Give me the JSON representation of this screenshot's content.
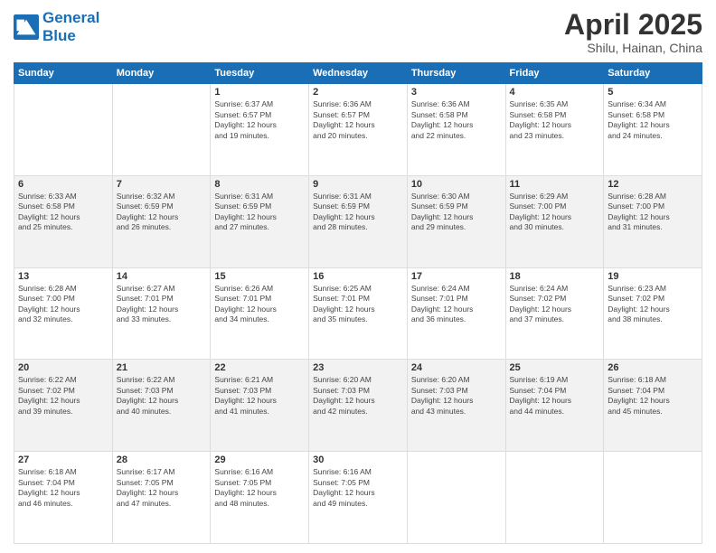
{
  "header": {
    "logo_line1": "General",
    "logo_line2": "Blue",
    "title": "April 2025",
    "subtitle": "Shilu, Hainan, China"
  },
  "days_of_week": [
    "Sunday",
    "Monday",
    "Tuesday",
    "Wednesday",
    "Thursday",
    "Friday",
    "Saturday"
  ],
  "weeks": [
    [
      {
        "day": "",
        "info": ""
      },
      {
        "day": "",
        "info": ""
      },
      {
        "day": "1",
        "info": "Sunrise: 6:37 AM\nSunset: 6:57 PM\nDaylight: 12 hours\nand 19 minutes."
      },
      {
        "day": "2",
        "info": "Sunrise: 6:36 AM\nSunset: 6:57 PM\nDaylight: 12 hours\nand 20 minutes."
      },
      {
        "day": "3",
        "info": "Sunrise: 6:36 AM\nSunset: 6:58 PM\nDaylight: 12 hours\nand 22 minutes."
      },
      {
        "day": "4",
        "info": "Sunrise: 6:35 AM\nSunset: 6:58 PM\nDaylight: 12 hours\nand 23 minutes."
      },
      {
        "day": "5",
        "info": "Sunrise: 6:34 AM\nSunset: 6:58 PM\nDaylight: 12 hours\nand 24 minutes."
      }
    ],
    [
      {
        "day": "6",
        "info": "Sunrise: 6:33 AM\nSunset: 6:58 PM\nDaylight: 12 hours\nand 25 minutes."
      },
      {
        "day": "7",
        "info": "Sunrise: 6:32 AM\nSunset: 6:59 PM\nDaylight: 12 hours\nand 26 minutes."
      },
      {
        "day": "8",
        "info": "Sunrise: 6:31 AM\nSunset: 6:59 PM\nDaylight: 12 hours\nand 27 minutes."
      },
      {
        "day": "9",
        "info": "Sunrise: 6:31 AM\nSunset: 6:59 PM\nDaylight: 12 hours\nand 28 minutes."
      },
      {
        "day": "10",
        "info": "Sunrise: 6:30 AM\nSunset: 6:59 PM\nDaylight: 12 hours\nand 29 minutes."
      },
      {
        "day": "11",
        "info": "Sunrise: 6:29 AM\nSunset: 7:00 PM\nDaylight: 12 hours\nand 30 minutes."
      },
      {
        "day": "12",
        "info": "Sunrise: 6:28 AM\nSunset: 7:00 PM\nDaylight: 12 hours\nand 31 minutes."
      }
    ],
    [
      {
        "day": "13",
        "info": "Sunrise: 6:28 AM\nSunset: 7:00 PM\nDaylight: 12 hours\nand 32 minutes."
      },
      {
        "day": "14",
        "info": "Sunrise: 6:27 AM\nSunset: 7:01 PM\nDaylight: 12 hours\nand 33 minutes."
      },
      {
        "day": "15",
        "info": "Sunrise: 6:26 AM\nSunset: 7:01 PM\nDaylight: 12 hours\nand 34 minutes."
      },
      {
        "day": "16",
        "info": "Sunrise: 6:25 AM\nSunset: 7:01 PM\nDaylight: 12 hours\nand 35 minutes."
      },
      {
        "day": "17",
        "info": "Sunrise: 6:24 AM\nSunset: 7:01 PM\nDaylight: 12 hours\nand 36 minutes."
      },
      {
        "day": "18",
        "info": "Sunrise: 6:24 AM\nSunset: 7:02 PM\nDaylight: 12 hours\nand 37 minutes."
      },
      {
        "day": "19",
        "info": "Sunrise: 6:23 AM\nSunset: 7:02 PM\nDaylight: 12 hours\nand 38 minutes."
      }
    ],
    [
      {
        "day": "20",
        "info": "Sunrise: 6:22 AM\nSunset: 7:02 PM\nDaylight: 12 hours\nand 39 minutes."
      },
      {
        "day": "21",
        "info": "Sunrise: 6:22 AM\nSunset: 7:03 PM\nDaylight: 12 hours\nand 40 minutes."
      },
      {
        "day": "22",
        "info": "Sunrise: 6:21 AM\nSunset: 7:03 PM\nDaylight: 12 hours\nand 41 minutes."
      },
      {
        "day": "23",
        "info": "Sunrise: 6:20 AM\nSunset: 7:03 PM\nDaylight: 12 hours\nand 42 minutes."
      },
      {
        "day": "24",
        "info": "Sunrise: 6:20 AM\nSunset: 7:03 PM\nDaylight: 12 hours\nand 43 minutes."
      },
      {
        "day": "25",
        "info": "Sunrise: 6:19 AM\nSunset: 7:04 PM\nDaylight: 12 hours\nand 44 minutes."
      },
      {
        "day": "26",
        "info": "Sunrise: 6:18 AM\nSunset: 7:04 PM\nDaylight: 12 hours\nand 45 minutes."
      }
    ],
    [
      {
        "day": "27",
        "info": "Sunrise: 6:18 AM\nSunset: 7:04 PM\nDaylight: 12 hours\nand 46 minutes."
      },
      {
        "day": "28",
        "info": "Sunrise: 6:17 AM\nSunset: 7:05 PM\nDaylight: 12 hours\nand 47 minutes."
      },
      {
        "day": "29",
        "info": "Sunrise: 6:16 AM\nSunset: 7:05 PM\nDaylight: 12 hours\nand 48 minutes."
      },
      {
        "day": "30",
        "info": "Sunrise: 6:16 AM\nSunset: 7:05 PM\nDaylight: 12 hours\nand 49 minutes."
      },
      {
        "day": "",
        "info": ""
      },
      {
        "day": "",
        "info": ""
      },
      {
        "day": "",
        "info": ""
      }
    ]
  ]
}
